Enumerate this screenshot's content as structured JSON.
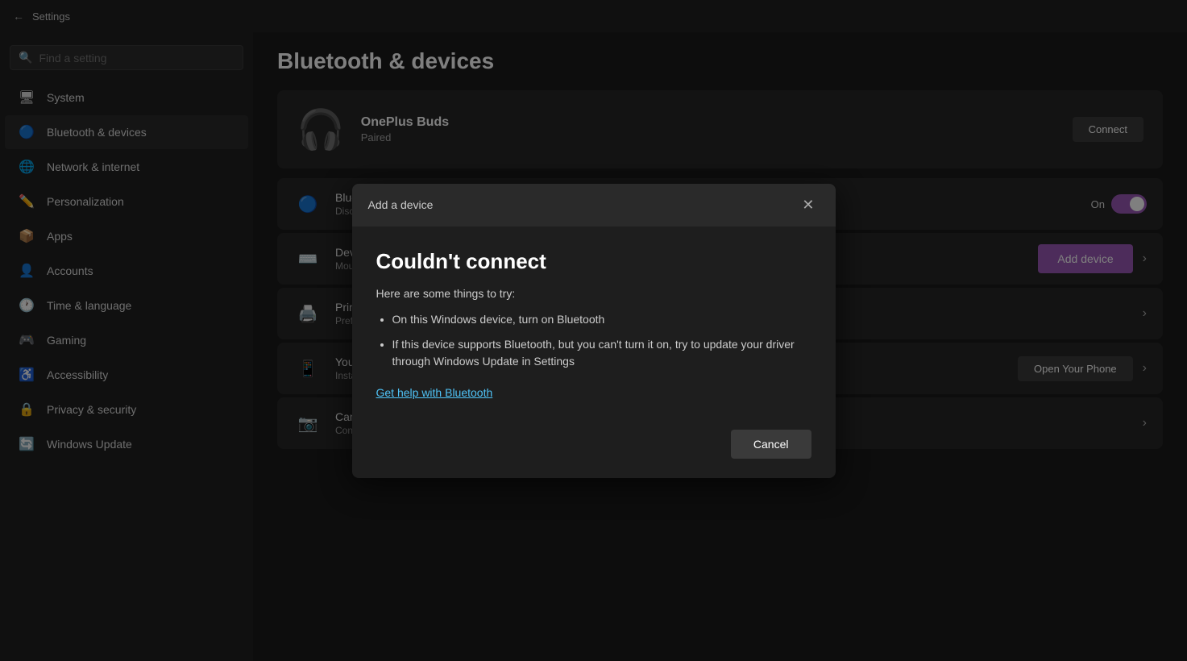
{
  "titlebar": {
    "back_icon": "←",
    "title": "Settings"
  },
  "sidebar": {
    "search_placeholder": "Find a setting",
    "nav_items": [
      {
        "id": "system",
        "label": "System",
        "icon": "🖥",
        "active": false
      },
      {
        "id": "bluetooth",
        "label": "Bluetooth & devices",
        "icon": "🔵",
        "active": true
      },
      {
        "id": "network",
        "label": "Network & internet",
        "icon": "🌐",
        "active": false
      },
      {
        "id": "personalization",
        "label": "Personalization",
        "icon": "✏️",
        "active": false
      },
      {
        "id": "apps",
        "label": "Apps",
        "icon": "📦",
        "active": false
      },
      {
        "id": "accounts",
        "label": "Accounts",
        "icon": "👤",
        "active": false
      },
      {
        "id": "time",
        "label": "Time & language",
        "icon": "🕐",
        "active": false
      },
      {
        "id": "gaming",
        "label": "Gaming",
        "icon": "🎮",
        "active": false
      },
      {
        "id": "accessibility",
        "label": "Accessibility",
        "icon": "♿",
        "active": false
      },
      {
        "id": "privacy",
        "label": "Privacy & security",
        "icon": "🔒",
        "active": false
      },
      {
        "id": "winupdate",
        "label": "Windows Update",
        "icon": "🔄",
        "active": false
      }
    ]
  },
  "content": {
    "page_title": "Bluetooth & devices",
    "device_card": {
      "device_name": "OnePlus Buds",
      "device_status": "Paired",
      "connect_label": "Connect"
    },
    "rows": [
      {
        "id": "bluetooth",
        "title": "Bluetooth",
        "subtitle": "Discoverable as \"VIV",
        "has_toggle": true,
        "toggle_label": "On",
        "toggle_on": true
      },
      {
        "id": "devices",
        "title": "Devices",
        "subtitle": "Mouse, keyboard, pe",
        "has_add_device": true,
        "add_device_label": "Add device",
        "has_chevron": true
      },
      {
        "id": "printers",
        "title": "Printers & scanners",
        "subtitle": "Preferences, troubles",
        "has_chevron": true
      },
      {
        "id": "yourphone",
        "title": "Your Phone",
        "subtitle": "Instantly access your",
        "has_open_phone": true,
        "open_phone_label": "Open Your Phone",
        "has_chevron": true
      },
      {
        "id": "cameras",
        "title": "Cameras",
        "subtitle": "Connected cameras, default image settings",
        "has_chevron": true
      }
    ]
  },
  "dialog": {
    "header_title": "Add a device",
    "close_label": "✕",
    "main_title": "Couldn't connect",
    "subtitle": "Here are some things to try:",
    "bullets": [
      "On this Windows device, turn on Bluetooth",
      "If this device supports Bluetooth, but you can't turn it on, try to update your driver through Windows Update in Settings"
    ],
    "help_link": "Get help with Bluetooth",
    "cancel_label": "Cancel"
  }
}
